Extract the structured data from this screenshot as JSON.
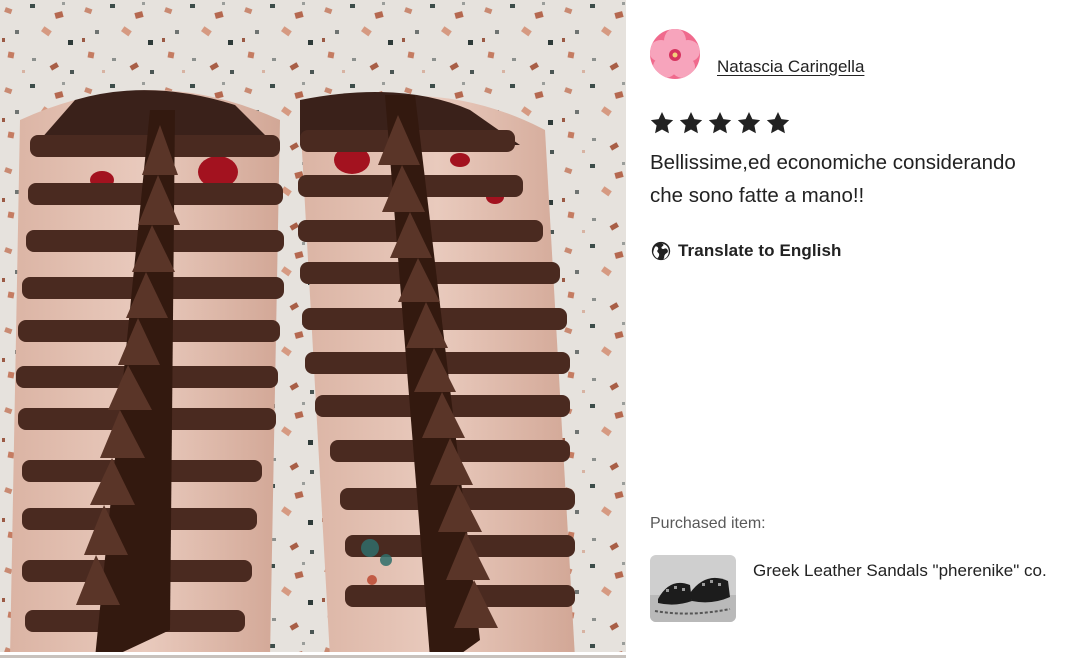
{
  "review": {
    "author": "Natascia Caringella",
    "rating": 5,
    "max_rating": 5,
    "text_lines": [
      "Bellissime,ed economiche considerando",
      "che sono fatte a mano!!"
    ],
    "translate_label": "Translate to English",
    "purchased_label": "Purchased item:",
    "item_name": "Greek Leather Sandals \"pherenike\" co."
  },
  "icons": {
    "star": "star-icon",
    "translate": "globe-icon"
  },
  "colors": {
    "text": "#222222",
    "muted": "#595959",
    "star": "#222222",
    "leather": "#4a2a20",
    "polish": "#a3121f"
  }
}
